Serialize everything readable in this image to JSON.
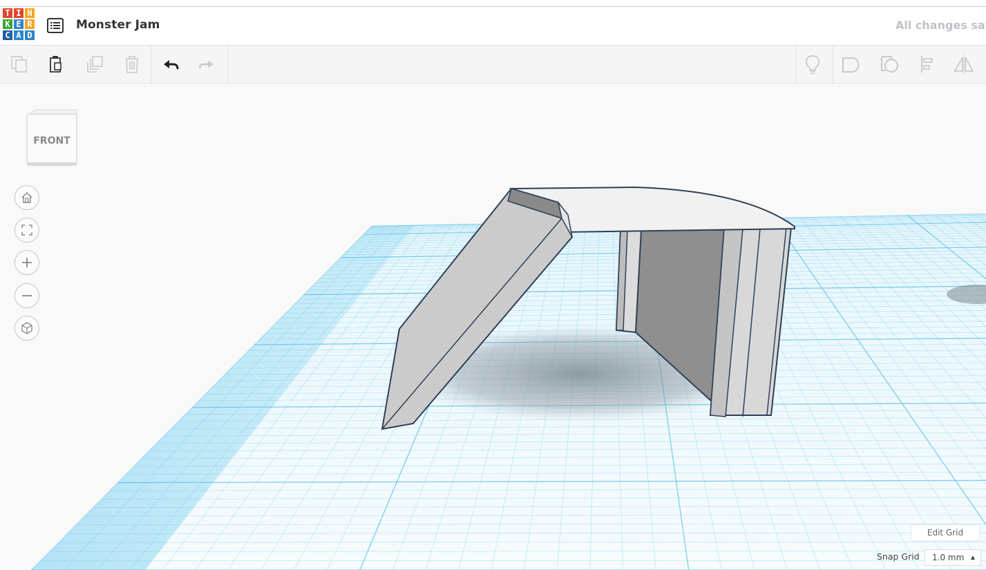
{
  "app": {
    "logo_letters": [
      "T",
      "I",
      "N",
      "K",
      "E",
      "R",
      "C",
      "A",
      "D"
    ],
    "logo_colors": [
      "#e2452b",
      "#e2452b",
      "#f5a623",
      "#3fa535",
      "#2f86c9",
      "#f5a623",
      "#1f5fa6",
      "#2f86c9",
      "#2f86c9"
    ],
    "design_title": "Monster Jam",
    "save_status": "All changes sav"
  },
  "toolbar": {
    "left_tools": [
      {
        "icon": "copy-icon",
        "enabled": false
      },
      {
        "icon": "paste-icon",
        "enabled": true
      },
      {
        "icon": "duplicate-icon",
        "enabled": false
      },
      {
        "icon": "delete-icon",
        "enabled": false
      },
      {
        "icon": "undo-icon",
        "enabled": true
      },
      {
        "icon": "redo-icon",
        "enabled": false
      }
    ],
    "right_tools": [
      {
        "icon": "show-all-icon"
      },
      {
        "icon": "group-icon"
      },
      {
        "icon": "ungroup-icon"
      },
      {
        "icon": "align-icon"
      },
      {
        "icon": "mirror-icon"
      }
    ]
  },
  "viewcube": {
    "face_label": "FRONT"
  },
  "view_controls": [
    {
      "icon": "home-view-icon"
    },
    {
      "icon": "fit-all-icon"
    },
    {
      "icon": "zoom-in-icon"
    },
    {
      "icon": "zoom-out-icon"
    },
    {
      "icon": "perspective-icon"
    }
  ],
  "grid": {
    "edit_grid_label": "Edit Grid",
    "snap_grid_label": "Snap Grid",
    "snap_grid_value": "1.0 mm"
  },
  "colors": {
    "grid_blue": "#5fc3e6",
    "shape_fill": "#d7d7d7",
    "shape_outline": "#2e3e57"
  }
}
